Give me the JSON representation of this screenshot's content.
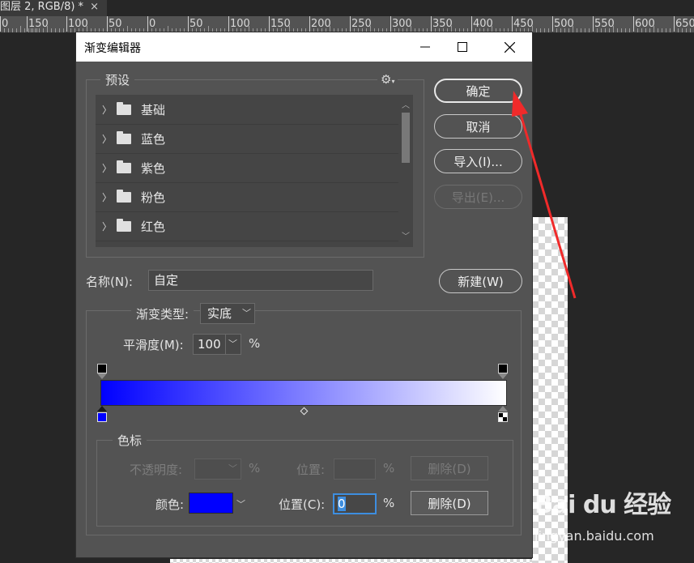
{
  "document": {
    "tab_title": "图层 2, RGB/8) *",
    "tab_close": "×",
    "ruler_labels": [
      "0",
      "150",
      "100",
      "50",
      "0",
      "50",
      "100",
      "150",
      "200",
      "250",
      "300",
      "350",
      "400",
      "450",
      "500",
      "550",
      "600",
      "650"
    ]
  },
  "dialog": {
    "title": "渐变编辑器",
    "minimize": "—",
    "maximize": "☐",
    "close": "✕"
  },
  "presets": {
    "legend": "预设",
    "gear": "⚙",
    "items": [
      {
        "label": "基础"
      },
      {
        "label": "蓝色"
      },
      {
        "label": "紫色"
      },
      {
        "label": "粉色"
      },
      {
        "label": "红色"
      }
    ]
  },
  "buttons": {
    "ok": "确定",
    "cancel": "取消",
    "import": "导入(I)...",
    "export": "导出(E)...",
    "new": "新建(W)"
  },
  "name_field": {
    "label": "名称(N):",
    "value": "自定"
  },
  "gradient": {
    "type_label": "渐变类型:",
    "type_value": "实底",
    "smooth_label": "平滑度(M):",
    "smooth_value": "100",
    "smooth_unit": "%",
    "start_color": "#0000ff",
    "end_color": "#ffffff"
  },
  "color_stops": {
    "legend": "色标",
    "opacity_label": "不透明度:",
    "opacity_unit": "%",
    "opacity_position_label": "位置:",
    "opacity_position_unit": "%",
    "opacity_delete": "删除(D)",
    "color_label": "颜色:",
    "color_value": "#0000ff",
    "position_label": "位置(C):",
    "position_value": "0",
    "position_unit": "%",
    "color_delete": "删除(D)"
  },
  "watermark": {
    "logo": "Bai du 经验",
    "url": "jingyan.baidu.com"
  }
}
